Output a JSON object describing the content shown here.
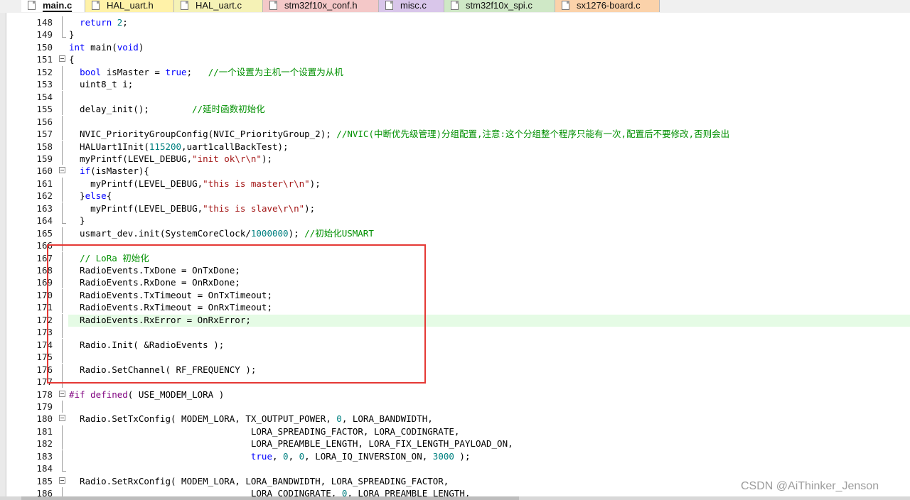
{
  "tabs": [
    {
      "label": "main.c",
      "active": true,
      "bg": "#ffffff"
    },
    {
      "label": "HAL_uart.h",
      "active": false,
      "bg": "#fff2a8"
    },
    {
      "label": "HAL_uart.c",
      "active": false,
      "bg": "#f5f2b6"
    },
    {
      "label": "stm32f10x_conf.h",
      "active": false,
      "bg": "#f4c8c8"
    },
    {
      "label": "misc.c",
      "active": false,
      "bg": "#d9c6ea"
    },
    {
      "label": "stm32f10x_spi.c",
      "active": false,
      "bg": "#cfe8c6"
    },
    {
      "label": "sx1276-board.c",
      "active": false,
      "bg": "#fbd2aa"
    }
  ],
  "editor": {
    "highlighted_line": "172",
    "lines": [
      {
        "n": "148",
        "fold": "line",
        "segs": [
          [
            "  ",
            ""
          ],
          [
            "return",
            "kw"
          ],
          [
            " ",
            ""
          ],
          [
            "2",
            "num"
          ],
          [
            ";",
            ""
          ]
        ]
      },
      {
        "n": "149",
        "fold": "end",
        "segs": [
          [
            "}",
            ""
          ]
        ]
      },
      {
        "n": "150",
        "fold": "",
        "segs": [
          [
            "int",
            "kw"
          ],
          [
            " main(",
            ""
          ],
          [
            "void",
            "kw"
          ],
          [
            ")",
            ""
          ]
        ]
      },
      {
        "n": "151",
        "fold": "open",
        "segs": [
          [
            "{",
            ""
          ]
        ]
      },
      {
        "n": "152",
        "fold": "line",
        "segs": [
          [
            "  ",
            ""
          ],
          [
            "bool",
            "kw"
          ],
          [
            " isMaster = ",
            ""
          ],
          [
            "true",
            "kw"
          ],
          [
            ";   ",
            ""
          ],
          [
            "//一个设置为主机一个设置为从机",
            "cm"
          ]
        ]
      },
      {
        "n": "153",
        "fold": "line",
        "segs": [
          [
            "  uint8_t i;",
            ""
          ]
        ]
      },
      {
        "n": "154",
        "fold": "line",
        "segs": [
          [
            "",
            ""
          ]
        ]
      },
      {
        "n": "155",
        "fold": "line",
        "segs": [
          [
            "  delay_init();        ",
            ""
          ],
          [
            "//延时函数初始化",
            "cm"
          ]
        ]
      },
      {
        "n": "156",
        "fold": "line",
        "segs": [
          [
            "",
            ""
          ]
        ]
      },
      {
        "n": "157",
        "fold": "line",
        "segs": [
          [
            "  NVIC_PriorityGroupConfig(NVIC_PriorityGroup_2); ",
            ""
          ],
          [
            "//NVIC(中断优先级管理)分组配置,注意:这个分组整个程序只能有一次,配置后不要修改,否则会出",
            "cm"
          ]
        ]
      },
      {
        "n": "158",
        "fold": "line",
        "segs": [
          [
            "  HALUart1Init(",
            ""
          ],
          [
            "115200",
            "num"
          ],
          [
            ",uart1callBackTest);",
            ""
          ]
        ]
      },
      {
        "n": "159",
        "fold": "line",
        "segs": [
          [
            "  myPrintf(LEVEL_DEBUG,",
            ""
          ],
          [
            "\"init ok\\r\\n\"",
            "str"
          ],
          [
            ");",
            ""
          ]
        ]
      },
      {
        "n": "160",
        "fold": "open",
        "segs": [
          [
            "  ",
            ""
          ],
          [
            "if",
            "kw"
          ],
          [
            "(isMaster){",
            ""
          ]
        ]
      },
      {
        "n": "161",
        "fold": "line",
        "segs": [
          [
            "    myPrintf(LEVEL_DEBUG,",
            ""
          ],
          [
            "\"this is master\\r\\n\"",
            "str"
          ],
          [
            ");",
            ""
          ]
        ]
      },
      {
        "n": "162",
        "fold": "line",
        "segs": [
          [
            "  }",
            ""
          ],
          [
            "else",
            "kw"
          ],
          [
            "{",
            ""
          ]
        ]
      },
      {
        "n": "163",
        "fold": "line",
        "segs": [
          [
            "    myPrintf(LEVEL_DEBUG,",
            ""
          ],
          [
            "\"this is slave\\r\\n\"",
            "str"
          ],
          [
            ");",
            ""
          ]
        ]
      },
      {
        "n": "164",
        "fold": "end",
        "segs": [
          [
            "  }",
            ""
          ]
        ]
      },
      {
        "n": "165",
        "fold": "line",
        "segs": [
          [
            "  usmart_dev.init(SystemCoreClock/",
            ""
          ],
          [
            "1000000",
            "num"
          ],
          [
            "); ",
            ""
          ],
          [
            "//初始化USMART",
            "cm"
          ]
        ]
      },
      {
        "n": "166",
        "fold": "line",
        "segs": [
          [
            "",
            ""
          ]
        ]
      },
      {
        "n": "167",
        "fold": "line",
        "segs": [
          [
            "  ",
            ""
          ],
          [
            "// LoRa 初始化",
            "cm"
          ]
        ]
      },
      {
        "n": "168",
        "fold": "line",
        "segs": [
          [
            "  RadioEvents.TxDone = OnTxDone;",
            ""
          ]
        ]
      },
      {
        "n": "169",
        "fold": "line",
        "segs": [
          [
            "  RadioEvents.RxDone = OnRxDone;",
            ""
          ]
        ]
      },
      {
        "n": "170",
        "fold": "line",
        "segs": [
          [
            "  RadioEvents.TxTimeout = OnTxTimeout;",
            ""
          ]
        ]
      },
      {
        "n": "171",
        "fold": "line",
        "segs": [
          [
            "  RadioEvents.RxTimeout = OnRxTimeout;",
            ""
          ]
        ]
      },
      {
        "n": "172",
        "fold": "line",
        "segs": [
          [
            "  RadioEvents.RxError = OnRxError;",
            ""
          ]
        ]
      },
      {
        "n": "173",
        "fold": "line",
        "segs": [
          [
            "",
            ""
          ]
        ]
      },
      {
        "n": "174",
        "fold": "line",
        "segs": [
          [
            "  Radio.Init( &RadioEvents );",
            ""
          ]
        ]
      },
      {
        "n": "175",
        "fold": "line",
        "segs": [
          [
            "",
            ""
          ]
        ]
      },
      {
        "n": "176",
        "fold": "line",
        "segs": [
          [
            "  Radio.SetChannel( RF_FREQUENCY );",
            ""
          ]
        ]
      },
      {
        "n": "177",
        "fold": "line",
        "segs": [
          [
            "",
            ""
          ]
        ]
      },
      {
        "n": "178",
        "fold": "open",
        "segs": [
          [
            "#if",
            "pp"
          ],
          [
            " ",
            ""
          ],
          [
            "defined",
            "pp"
          ],
          [
            "( USE_MODEM_LORA )",
            ""
          ]
        ]
      },
      {
        "n": "179",
        "fold": "line",
        "segs": [
          [
            "",
            ""
          ]
        ]
      },
      {
        "n": "180",
        "fold": "open",
        "segs": [
          [
            "  Radio.SetTxConfig( MODEM_LORA, TX_OUTPUT_POWER, ",
            ""
          ],
          [
            "0",
            "num"
          ],
          [
            ", LORA_BANDWIDTH,",
            ""
          ]
        ]
      },
      {
        "n": "181",
        "fold": "line",
        "segs": [
          [
            "                                  LORA_SPREADING_FACTOR, LORA_CODINGRATE,",
            ""
          ]
        ]
      },
      {
        "n": "182",
        "fold": "line",
        "segs": [
          [
            "                                  LORA_PREAMBLE_LENGTH, LORA_FIX_LENGTH_PAYLOAD_ON,",
            ""
          ]
        ]
      },
      {
        "n": "183",
        "fold": "line",
        "segs": [
          [
            "                                  ",
            ""
          ],
          [
            "true",
            "kw"
          ],
          [
            ", ",
            ""
          ],
          [
            "0",
            "num"
          ],
          [
            ", ",
            ""
          ],
          [
            "0",
            "num"
          ],
          [
            ", LORA_IQ_INVERSION_ON, ",
            ""
          ],
          [
            "3000",
            "num"
          ],
          [
            " );",
            ""
          ]
        ]
      },
      {
        "n": "184",
        "fold": "end",
        "segs": [
          [
            "",
            ""
          ]
        ]
      },
      {
        "n": "185",
        "fold": "open",
        "segs": [
          [
            "  Radio.SetRxConfig( MODEM_LORA, LORA_BANDWIDTH, LORA_SPREADING_FACTOR,",
            ""
          ]
        ]
      },
      {
        "n": "186",
        "fold": "line",
        "segs": [
          [
            "                                  LORA_CODINGRATE, ",
            ""
          ],
          [
            "0",
            "num"
          ],
          [
            ", LORA_PREAMBLE_LENGTH,",
            ""
          ]
        ]
      }
    ]
  },
  "watermark": "CSDN @AiThinker_Jenson",
  "annotation_color": "#e53935"
}
